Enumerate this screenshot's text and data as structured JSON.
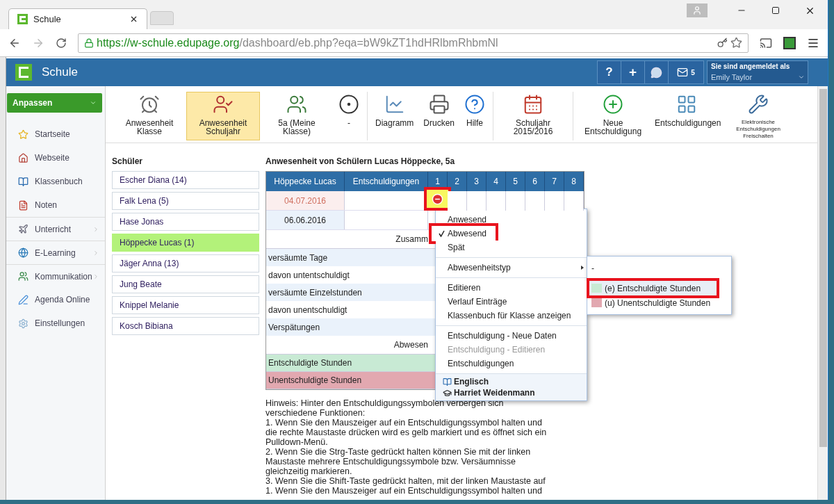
{
  "browser": {
    "tab_title": "Schule",
    "url_host": "https://w-schule.edupage.org",
    "url_path": "/dashboard/eb.php?eqa=bW9kZT1hdHRlbmRhbmNl"
  },
  "app": {
    "title": "Schule",
    "mail_count": "5",
    "login_label": "Sie sind angemeldet als",
    "user": "Emily Taylor",
    "help": "?",
    "add": "+"
  },
  "sidebar": {
    "button": "Anpassen",
    "items": [
      {
        "label": "Startseite",
        "submenu": false
      },
      {
        "label": "Webseite",
        "submenu": false
      },
      {
        "label": "Klassenbuch",
        "submenu": false
      },
      {
        "label": "Noten",
        "submenu": false
      },
      {
        "label": "Unterricht",
        "submenu": true
      },
      {
        "label": "E-Learning",
        "submenu": true
      },
      {
        "label": "Kommunikation",
        "submenu": true
      },
      {
        "label": "Agenda Online",
        "submenu": false
      },
      {
        "label": "Einstellungen",
        "submenu": false
      }
    ]
  },
  "toolbar": [
    {
      "label": "Anwesenheit Klasse",
      "selected": false
    },
    {
      "label": "Anwesenheit Schuljahr",
      "selected": true
    },
    {
      "label": "5a (Meine Klasse)",
      "selected": false
    },
    {
      "label": "-",
      "selected": false
    },
    {
      "label": "Diagramm",
      "selected": false
    },
    {
      "label": "Drucken",
      "selected": false
    },
    {
      "label": "Hilfe",
      "selected": false
    },
    {
      "label": "Schuljahr 2015/2016",
      "selected": false
    },
    {
      "label": "Neue Entschuldigung",
      "selected": false
    },
    {
      "label": "Entschuldigungen",
      "selected": false
    },
    {
      "label": "Elektronische Entschuldigungen Freischalten",
      "selected": false
    }
  ],
  "students": {
    "title": "Schüler",
    "items": [
      {
        "name": "Escher Diana (14)",
        "selected": false
      },
      {
        "name": "Falk Lena (5)",
        "selected": false
      },
      {
        "name": "Hase Jonas",
        "selected": false
      },
      {
        "name": "Höppecke Lucas (1)",
        "selected": true
      },
      {
        "name": "Jäger Anna (13)",
        "selected": false
      },
      {
        "name": "Jung Beate",
        "selected": false
      },
      {
        "name": "Knippel Melanie",
        "selected": false
      },
      {
        "name": "Kosch Bibiana",
        "selected": false
      }
    ]
  },
  "attendance": {
    "title": "Anwesenheit von Schülern Lucas Höppecke, 5a",
    "columns": [
      "Höppecke Lucas",
      "Entschuldigungen",
      "1",
      "2",
      "3",
      "4",
      "5",
      "6",
      "7",
      "8"
    ],
    "rows": [
      {
        "date": "04.07.2016",
        "flagged": true,
        "periods": [
          {
            "absent": true,
            "selected": true,
            "highlighted": true
          },
          {
            "absent": false,
            "selected": false,
            "highlighted": false
          },
          {
            "absent": false,
            "selected": false,
            "highlighted": false
          },
          {
            "absent": false,
            "selected": false,
            "highlighted": false
          },
          {
            "absent": false,
            "selected": false,
            "highlighted": false
          },
          {
            "absent": false,
            "selected": false,
            "highlighted": false
          },
          {
            "absent": false,
            "selected": false,
            "highlighted": false
          },
          {
            "absent": false,
            "selected": false,
            "highlighted": false
          }
        ]
      },
      {
        "date": "06.06.2016",
        "flagged": false
      }
    ],
    "summary": [
      {
        "kind": "heading",
        "label": "Zusamm"
      },
      {
        "kind": "row",
        "label": "versäumte Tage"
      },
      {
        "kind": "row",
        "label": "davon untentschuldigt"
      },
      {
        "kind": "row",
        "label": "versäumte Einzelstunden"
      },
      {
        "kind": "row",
        "label": "davon unentschuldigt"
      },
      {
        "kind": "row",
        "label": "Verspätungen"
      },
      {
        "kind": "heading",
        "label": "Abwesen"
      },
      {
        "kind": "legend",
        "label": "Entschuldigte Stunden",
        "color": "#c8ead4"
      },
      {
        "kind": "legend",
        "label": "Unentschuldigte Stunden",
        "color": "#e2a8b0"
      }
    ],
    "hint": [
      "Hinweis: Hinter den Entschuldigungssymbolen verbergen sich verschiedene Funktionen:",
      "1. Wenn Sie den Mauszeiger auf ein Entschuldigungssymbol halten und die rechte Maustaste drücken wird es gelb markiert und es öffnet sich ein Pulldown-Menü.",
      "2. Wenn Sie die Strg-Taste gedrückt halten können Sie mit der linken Maustaste mehrere Entschuldigungssymbole bzw. Versäumnisse gleichzeitig markieren.",
      "3. Wenn Sie die Shift-Taste gedrückt halten, mit der linken Maustaste auf",
      "1. Wenn Sie den Mauszeiger auf ein Entschuldigungssymbol halten und"
    ]
  },
  "context_menu": {
    "items": [
      {
        "kind": "item",
        "label": "Anwesend",
        "checked": false,
        "highlighted": false,
        "disabled": false
      },
      {
        "kind": "item",
        "label": "Abwesend",
        "checked": true,
        "highlighted": true,
        "disabled": false
      },
      {
        "kind": "item",
        "label": "Spät",
        "checked": false,
        "highlighted": false,
        "disabled": false
      },
      {
        "kind": "separator"
      },
      {
        "kind": "submenu",
        "label": "Abwesenheitstyp"
      },
      {
        "kind": "separator"
      },
      {
        "kind": "item",
        "label": "Editieren",
        "checked": false,
        "highlighted": false,
        "disabled": false
      },
      {
        "kind": "item",
        "label": "Verlauf Einträge",
        "checked": false,
        "highlighted": false,
        "disabled": false
      },
      {
        "kind": "item",
        "label": "Klassenbuch für Klasse anzeigen",
        "checked": false,
        "highlighted": false,
        "disabled": false
      },
      {
        "kind": "separator"
      },
      {
        "kind": "item",
        "label": "Entschuldigung - Neue Daten",
        "checked": false,
        "highlighted": false,
        "disabled": false
      },
      {
        "kind": "item",
        "label": "Entschuldigung - Editieren",
        "checked": false,
        "highlighted": false,
        "disabled": true
      },
      {
        "kind": "item",
        "label": "Entschuldigungen",
        "checked": false,
        "highlighted": false,
        "disabled": false
      }
    ],
    "footer": [
      "Englisch",
      "Harriet Weidenmann"
    ]
  },
  "submenu": {
    "items": [
      {
        "label": "-",
        "selected": false,
        "highlighted": false
      },
      {
        "label": "(e) Entschuldigte Stunden",
        "color": "#c8ead4",
        "selected": true,
        "highlighted": true
      },
      {
        "label": "(u) Unentschuldigte Stunden",
        "color": "#e2a8b0",
        "selected": false,
        "highlighted": false
      }
    ]
  }
}
